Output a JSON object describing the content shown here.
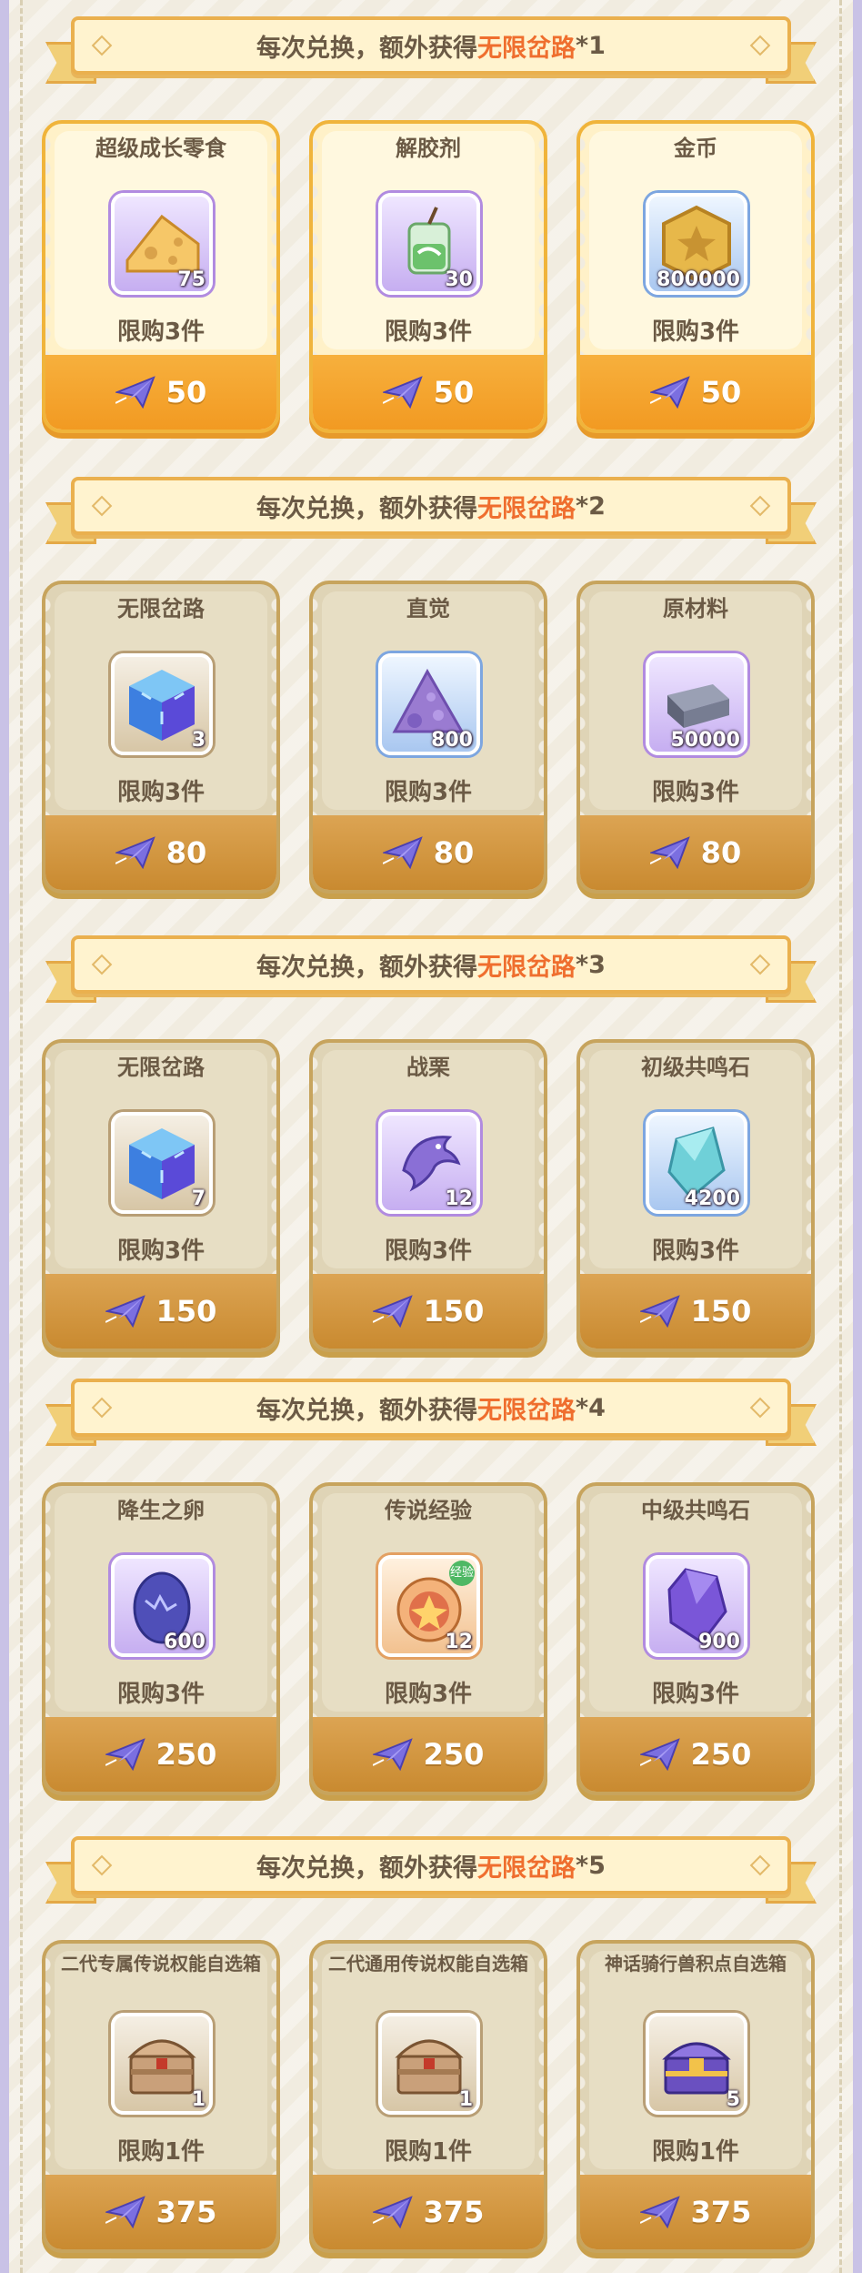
{
  "banner": {
    "prefix": "每次兑换，额外获得",
    "highlight": "无限岔路"
  },
  "sections": [
    {
      "multiplier": "*1",
      "style": "yellow",
      "cards": [
        {
          "name": "超级成长零食",
          "qty": "75",
          "limit": "限购3件",
          "price": "50",
          "icon": "cheese-icon",
          "frame": "purple"
        },
        {
          "name": "解胶剂",
          "qty": "30",
          "limit": "限购3件",
          "price": "50",
          "icon": "potion-icon",
          "frame": "purple"
        },
        {
          "name": "金币",
          "qty": "800000",
          "limit": "限购3件",
          "price": "50",
          "icon": "gold-coin-icon",
          "frame": "blue"
        }
      ]
    },
    {
      "multiplier": "*2",
      "style": "beige",
      "cards": [
        {
          "name": "无限岔路",
          "qty": "3",
          "limit": "限购3件",
          "price": "80",
          "icon": "cube-icon",
          "frame": "brown"
        },
        {
          "name": "直觉",
          "qty": "800",
          "limit": "限购3件",
          "price": "80",
          "icon": "crystal-pile-icon",
          "frame": "blue"
        },
        {
          "name": "原材料",
          "qty": "50000",
          "limit": "限购3件",
          "price": "80",
          "icon": "ingot-icon",
          "frame": "purple"
        }
      ]
    },
    {
      "multiplier": "*3",
      "style": "beige",
      "cards": [
        {
          "name": "无限岔路",
          "qty": "7",
          "limit": "限购3件",
          "price": "150",
          "icon": "cube-icon",
          "frame": "brown"
        },
        {
          "name": "战栗",
          "qty": "12",
          "limit": "限购3件",
          "price": "150",
          "icon": "dolphin-icon",
          "frame": "purple"
        },
        {
          "name": "初级共鸣石",
          "qty": "4200",
          "limit": "限购3件",
          "price": "150",
          "icon": "blue-gem-icon",
          "frame": "blue"
        }
      ]
    },
    {
      "multiplier": "*4",
      "style": "beige",
      "cards": [
        {
          "name": "降生之卵",
          "qty": "600",
          "limit": "限购3件",
          "price": "250",
          "icon": "egg-icon",
          "frame": "purple"
        },
        {
          "name": "传说经验",
          "qty": "12",
          "limit": "限购3件",
          "price": "250",
          "icon": "exp-orb-icon",
          "frame": "orange",
          "badge": "经验"
        },
        {
          "name": "中级共鸣石",
          "qty": "900",
          "limit": "限购3件",
          "price": "250",
          "icon": "purple-gem-icon",
          "frame": "purple"
        }
      ]
    },
    {
      "multiplier": "*5",
      "style": "beige",
      "cards": [
        {
          "name": "二代专属传说权能自选箱",
          "qty": "1",
          "limit": "限购1件",
          "price": "375",
          "icon": "chest-icon",
          "frame": "brown"
        },
        {
          "name": "二代通用传说权能自选箱",
          "qty": "1",
          "limit": "限购1件",
          "price": "375",
          "icon": "chest-icon",
          "frame": "brown"
        },
        {
          "name": "神话骑行兽积点自选箱",
          "qty": "5",
          "limit": "限购1件",
          "price": "375",
          "icon": "purple-chest-icon",
          "frame": "brown"
        }
      ]
    }
  ],
  "currency_icon": "paper-plane-icon",
  "colors": {
    "highlight": "#ef6e2e",
    "text": "#6b5a45",
    "price_bar_yellow": "#f29a22",
    "price_bar_beige": "#c98a30"
  }
}
